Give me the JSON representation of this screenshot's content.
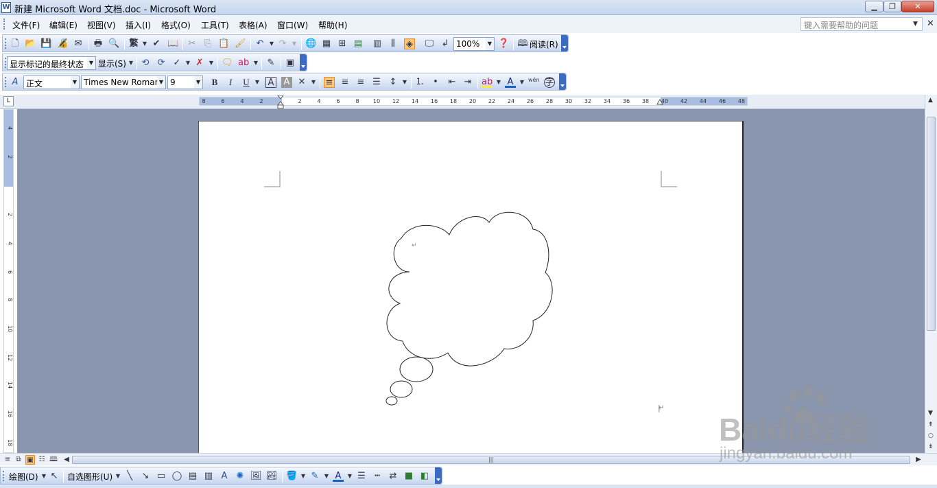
{
  "window": {
    "title": "新建 Microsoft Word 文档.doc - Microsoft Word",
    "app_icon": "W",
    "minimize_icon": "minimize-icon",
    "maximize_icon": "restore-icon",
    "close_label": "✕"
  },
  "menubar": {
    "items": [
      "文件(F)",
      "编辑(E)",
      "视图(V)",
      "插入(I)",
      "格式(O)",
      "工具(T)",
      "表格(A)",
      "窗口(W)",
      "帮助(H)"
    ],
    "help_placeholder": "键入需要帮助的问题",
    "doc_close": "✕"
  },
  "standard_toolbar": {
    "zoom": "100%",
    "read_label": "阅读(R)",
    "traditional_label": "繁"
  },
  "review_toolbar": {
    "display_mode": "显示标记的最终状态",
    "show_label": "显示(S)"
  },
  "format_toolbar": {
    "style": "正文",
    "font": "Times New Roman",
    "size": "9",
    "bold": "B",
    "italic": "I",
    "underline": "U",
    "phonetic": "wén"
  },
  "ruler": {
    "corner": "L",
    "h_ticks": [
      "8",
      "6",
      "4",
      "2",
      "2",
      "4",
      "6",
      "8",
      "10",
      "12",
      "14",
      "16",
      "18",
      "20",
      "22",
      "24",
      "26",
      "28",
      "30",
      "32",
      "34",
      "36",
      "38",
      "40",
      "42",
      "44",
      "46",
      "48"
    ],
    "v_ticks": [
      "4",
      "2",
      "2",
      "4",
      "6",
      "8",
      "10",
      "12",
      "14",
      "16",
      "18"
    ]
  },
  "document": {
    "paragraph_mark": "↵",
    "end_mark": "↵"
  },
  "drawing_toolbar": {
    "draw_label": "绘图(D)",
    "autoshapes_label": "自选图形(U)"
  },
  "watermark": {
    "brand": "Baidu经验",
    "url": "jingyan.baidu.com"
  },
  "colors": {
    "titlebar": "#c4d6ee",
    "toolbar_end": "#3c6cc2",
    "workspace": "#8a96ae",
    "highlight": "#ffc77a"
  }
}
